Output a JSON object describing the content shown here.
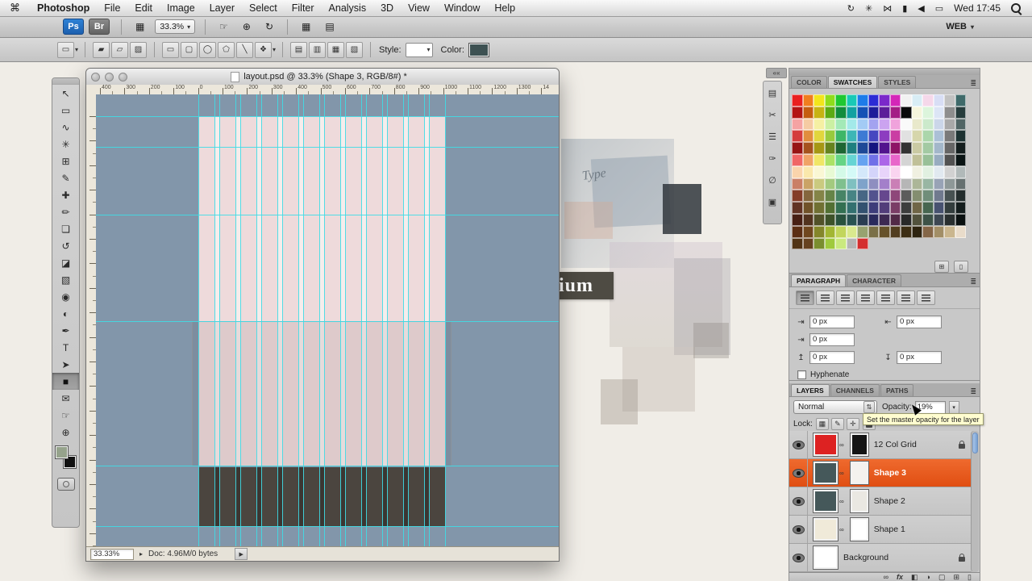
{
  "icons": {
    "dropdown": "▾",
    "panel_menu": "≣",
    "double_collapse": "««",
    "status_play": "▸",
    "status_arrow": "▶",
    "select_arrows": "⇅"
  },
  "menu_bar": {
    "apple_icon": "⌘",
    "items": [
      "Photoshop",
      "File",
      "Edit",
      "Image",
      "Layer",
      "Select",
      "Filter",
      "Analysis",
      "3D",
      "View",
      "Window",
      "Help"
    ],
    "status_icons": [
      {
        "name": "sync-icon",
        "glyph": "↻"
      },
      {
        "name": "spaces-icon",
        "glyph": "✳"
      },
      {
        "name": "bluetooth-icon",
        "glyph": "⋈"
      },
      {
        "name": "battery-icon",
        "glyph": "▮"
      },
      {
        "name": "volume-icon",
        "glyph": "◀"
      },
      {
        "name": "display-icon",
        "glyph": "▭"
      }
    ],
    "clock": "Wed 17:45"
  },
  "app_bar": {
    "ps": "Ps",
    "br": "Br",
    "launcher": "▦",
    "zoom": "33.3%",
    "tools": [
      {
        "name": "hand-tool-button",
        "glyph": "☞"
      },
      {
        "name": "zoom-tool-button",
        "glyph": "⊕"
      },
      {
        "name": "rotate-view-button",
        "glyph": "↻"
      }
    ],
    "views": [
      {
        "name": "arrange-documents-button",
        "glyph": "▦"
      },
      {
        "name": "screen-mode-button",
        "glyph": "▤"
      }
    ],
    "workspace": "WEB"
  },
  "tool_options": {
    "tool_icon": "▭",
    "mode_icons": [
      {
        "name": "shape-layers-mode",
        "glyph": "▰"
      },
      {
        "name": "paths-mode",
        "glyph": "▱"
      },
      {
        "name": "fill-pixels-mode",
        "glyph": "▨"
      }
    ],
    "shape_icons": [
      {
        "name": "rectangle-shape",
        "glyph": "▭"
      },
      {
        "name": "rounded-rectangle-shape",
        "glyph": "▢"
      },
      {
        "name": "ellipse-shape",
        "glyph": "◯"
      },
      {
        "name": "polygon-shape",
        "glyph": "⬠"
      },
      {
        "name": "line-shape",
        "glyph": "╲"
      },
      {
        "name": "custom-shape",
        "glyph": "❖"
      }
    ],
    "combine_icons": [
      {
        "name": "combine-add",
        "glyph": "▤"
      },
      {
        "name": "combine-subtract",
        "glyph": "▥"
      },
      {
        "name": "combine-intersect",
        "glyph": "▦"
      },
      {
        "name": "combine-exclude",
        "glyph": "▧"
      }
    ],
    "style_label": "Style:",
    "color_label": "Color:",
    "color_value": "#3d5152"
  },
  "toolbox": {
    "tools": [
      {
        "name": "move-tool",
        "glyph": "↖"
      },
      {
        "name": "marquee-tool",
        "glyph": "▭"
      },
      {
        "name": "lasso-tool",
        "glyph": "∿"
      },
      {
        "name": "quick-selection-tool",
        "glyph": "✳"
      },
      {
        "name": "crop-tool",
        "glyph": "⊞"
      },
      {
        "name": "eyedropper-tool",
        "glyph": "✎"
      },
      {
        "name": "healing-brush-tool",
        "glyph": "✚"
      },
      {
        "name": "brush-tool",
        "glyph": "✏"
      },
      {
        "name": "clone-stamp-tool",
        "glyph": "❏"
      },
      {
        "name": "history-brush-tool",
        "glyph": "↺"
      },
      {
        "name": "eraser-tool",
        "glyph": "◪"
      },
      {
        "name": "gradient-tool",
        "glyph": "▧"
      },
      {
        "name": "blur-tool",
        "glyph": "◉"
      },
      {
        "name": "dodge-tool",
        "glyph": "◐"
      },
      {
        "name": "pen-tool",
        "glyph": "✒"
      },
      {
        "name": "type-tool",
        "glyph": "T"
      },
      {
        "name": "path-selection-tool",
        "glyph": "➤"
      },
      {
        "name": "rectangle-tool",
        "glyph": "■",
        "selected": true
      },
      {
        "name": "notes-tool",
        "glyph": "✉"
      },
      {
        "name": "hand-tool",
        "glyph": "☞"
      },
      {
        "name": "zoom-tool",
        "glyph": "⊕"
      }
    ],
    "foreground": "#96a38c",
    "background": "#111111"
  },
  "doc": {
    "title": "layout.psd @ 33.3% (Shape 3, RGB/8#) *",
    "ruler_labels": [
      "400",
      "300",
      "200",
      "100",
      "0",
      "100",
      "200",
      "300",
      "400",
      "500",
      "600",
      "700",
      "800",
      "900",
      "1000",
      "1100",
      "1200",
      "1300",
      "14"
    ],
    "zoom": "33.33%",
    "size": "Doc: 4.96M/0 bytes"
  },
  "canvas": {
    "background": "#8296aa",
    "page": "#f6edec",
    "column": "#eedadb",
    "columns": 12,
    "guide": "#3fdce6",
    "dark_shape": "#3b3632",
    "dark_column": "#4b453f",
    "overlay": "rgba(90,70,70,0.10)",
    "h_guides": [
      27,
      65,
      149,
      281,
      460,
      535
    ]
  },
  "desktop": {
    "word": "ium",
    "word2": "Type"
  },
  "panels": {
    "collapsed": [
      {
        "name": "navigator-panel-icon",
        "glyph": "▤"
      },
      {
        "name": "scissors-panel-icon",
        "glyph": "✂"
      },
      {
        "name": "info-panel-icon",
        "glyph": "☰"
      },
      {
        "name": "brushes-panel-icon",
        "glyph": "✑"
      },
      {
        "name": "mask-panel-icon",
        "glyph": "∅"
      },
      {
        "name": "adjustments-panel-icon",
        "glyph": "▣"
      }
    ],
    "swatches": {
      "tabs": [
        "COLOR",
        "SWATCHES",
        "STYLES"
      ],
      "active": 1,
      "rows": [
        [
          "#e92020",
          "#f07d1e",
          "#f2e51c",
          "#8fdc1c",
          "#1fc832",
          "#19c9b6",
          "#1d7ce9",
          "#2b2bd5",
          "#7a28ca",
          "#d426b8",
          "#f2f2f2",
          "#d8edf5",
          "#f5d8ea",
          "#d8def5",
          "#c2c2c2",
          "#3f6a6a"
        ],
        [
          "#b31414",
          "#c55d10",
          "#c7b313",
          "#5caa13",
          "#128d3c",
          "#12a1a1",
          "#1452b5",
          "#1d1d99",
          "#5c1d99",
          "#a31d85",
          "#0a0a0a",
          "#f5f5dc",
          "#dcf5dc",
          "#dce5f5",
          "#8e8e8e",
          "#273d3d"
        ],
        [
          "#f5a3a3",
          "#f5cba3",
          "#f5f0a3",
          "#cbf0a3",
          "#a3e9b7",
          "#a3e9e9",
          "#a3cbf5",
          "#a3a3f0",
          "#cba3f0",
          "#f0a3dc",
          "#fafafa",
          "#e9e9cb",
          "#cbe9cb",
          "#cbd6e9",
          "#a9a9a9",
          "#516565"
        ],
        [
          "#d43d3d",
          "#e18d3d",
          "#e1d63d",
          "#98ca3d",
          "#3db667",
          "#3db6b6",
          "#3d7ad4",
          "#4747c0",
          "#8d3dc0",
          "#ca3da3",
          "#e1e1e1",
          "#d6d6ab",
          "#abd6ab",
          "#abc0d6",
          "#7a7a7a",
          "#1e3333"
        ],
        [
          "#971414",
          "#a6521e",
          "#a69714",
          "#66831e",
          "#1e6633",
          "#1e7f7f",
          "#1e4897",
          "#14147f",
          "#52148e",
          "#8e1466",
          "#333333",
          "#cacaa3",
          "#a3caa3",
          "#a3b7ca",
          "#666666",
          "#141e1e"
        ],
        [
          "#f06666",
          "#f0a366",
          "#f0e666",
          "#ace266",
          "#66d485",
          "#66d4d4",
          "#66a3f0",
          "#7070e8",
          "#ac66e8",
          "#e866ca",
          "#d4d4d4",
          "#c0c098",
          "#98c098",
          "#98acc0",
          "#525252",
          "#0a1414"
        ],
        [
          "#fad4ac",
          "#fae8ac",
          "#faf7d4",
          "#e8fad4",
          "#d4fae8",
          "#d4faf7",
          "#d4e8fa",
          "#d4d4fa",
          "#e8d4fa",
          "#fad4f0",
          "#ffffff",
          "#f0f0e1",
          "#e1f0e1",
          "#e1e9f0",
          "#d1d1d1",
          "#b1b9b9"
        ],
        [
          "#ca7f66",
          "#caa366",
          "#caca7f",
          "#a3ca7f",
          "#7fc08e",
          "#7fc0c0",
          "#7fa3ca",
          "#8e8ec0",
          "#a37fca",
          "#ca7fb6",
          "#b6b6b6",
          "#acb698",
          "#98b6a3",
          "#98a3b6",
          "#8e9898",
          "#667070"
        ],
        [
          "#843d29",
          "#84663d",
          "#848447",
          "#668447",
          "#478466",
          "#478484",
          "#476684",
          "#52528e",
          "#66478e",
          "#8e477a",
          "#5c5c5c",
          "#848e70",
          "#708e7a",
          "#707a8e",
          "#475252",
          "#242e2e"
        ],
        [
          "#613324",
          "#705229",
          "#707033",
          "#527033",
          "#337052",
          "#337070",
          "#335270",
          "#3d3d7a",
          "#523d7a",
          "#7a3d66",
          "#3d3d3d",
          "#706647",
          "#476650",
          "#475270",
          "#333d3d",
          "#141d1d"
        ],
        [
          "#471f14",
          "#52331f",
          "#525229",
          "#3d5229",
          "#29523d",
          "#295252",
          "#293d52",
          "#29295c",
          "#3d2952",
          "#522947",
          "#292929",
          "#52523d",
          "#3d5247",
          "#3d4752",
          "#292f2f",
          "#0a1010"
        ],
        [
          "#5c2e14",
          "#70471f",
          "#84862a",
          "#a2b633",
          "#c2d65c",
          "#dae98e",
          "#97a370",
          "#7a7047",
          "#66522a",
          "#523d1f",
          "#3d2e14",
          "#2e2410",
          "#846647",
          "#a28e66",
          "#cab68e",
          "#e9dcca"
        ],
        [
          "#523314",
          "#66421f",
          "#7a8e2e",
          "#9fca3d",
          "#cae97f",
          "#b5b5b5",
          "#d42e2e"
        ]
      ]
    },
    "paragraph": {
      "tabs": [
        "PARAGRAPH",
        "CHARACTER"
      ],
      "active": 0,
      "align_buttons": [
        {
          "name": "align-left-button",
          "selected": true
        },
        {
          "name": "align-center-button"
        },
        {
          "name": "align-right-button"
        },
        {
          "name": "justify-last-left-button"
        },
        {
          "name": "justify-last-center-button"
        },
        {
          "name": "justify-last-right-button"
        },
        {
          "name": "justify-all-button"
        }
      ],
      "fields": [
        {
          "name": "left-indent-field",
          "icon": "⇥",
          "value": "0 px",
          "col": 1,
          "row": 1
        },
        {
          "name": "right-indent-field",
          "icon": "⇤",
          "value": "0 px",
          "col": 2,
          "row": 1
        },
        {
          "name": "first-line-indent-field",
          "icon": "⇥",
          "value": "0 px",
          "col": 1,
          "row": 2
        },
        {
          "name": "space-before-field",
          "icon": "↥",
          "value": "0 px",
          "col": 1,
          "row": 3
        },
        {
          "name": "space-after-field",
          "icon": "↧",
          "value": "0 px",
          "col": 2,
          "row": 3
        }
      ],
      "hyphenate": "Hyphenate"
    },
    "layers": {
      "tabs": [
        "LAYERS",
        "CHANNELS",
        "PATHS"
      ],
      "active": 0,
      "blend": "Normal",
      "opacity_label": "Opacity:",
      "opacity": "19%",
      "lock_label": "Lock:",
      "lock_icons": [
        {
          "name": "lock-transparency-icon",
          "glyph": "▦"
        },
        {
          "name": "lock-pixels-icon",
          "glyph": "✎"
        },
        {
          "name": "lock-position-icon",
          "glyph": "✛"
        }
      ],
      "tooltip": "Set the master opacity for the layer",
      "selected_color": "#e8581c",
      "items": [
        {
          "name": "12 Col Grid",
          "thumb": "#dd2222",
          "thumb2": "#141414",
          "stripes": true,
          "locked": true,
          "selected": false
        },
        {
          "name": "Shape 3",
          "thumb": "#45585a",
          "thumb2": "#f4f2ee",
          "stripes": false,
          "locked": false,
          "selected": true
        },
        {
          "name": "Shape 2",
          "thumb": "#45585a",
          "thumb2": "#eae8e2",
          "stripes": false,
          "locked": false,
          "selected": false
        },
        {
          "name": "Shape 1",
          "thumb": "#f0ead9",
          "thumb2": "#ffffff",
          "stripes": false,
          "locked": false,
          "selected": false
        },
        {
          "name": "Background",
          "thumb": "#ffffff",
          "thumb2": null,
          "stripes": false,
          "locked": true,
          "selected": false
        }
      ],
      "bottom_icons": [
        {
          "name": "link-layers-icon",
          "glyph": "∞"
        },
        {
          "name": "layer-style-icon",
          "glyph": "fx"
        },
        {
          "name": "add-mask-icon",
          "glyph": "◧"
        },
        {
          "name": "adjustment-layer-icon",
          "glyph": "◑"
        },
        {
          "name": "layer-group-icon",
          "glyph": "▢"
        },
        {
          "name": "new-layer-icon",
          "glyph": "⊞"
        },
        {
          "name": "delete-layer-icon",
          "glyph": "▯"
        }
      ]
    }
  }
}
